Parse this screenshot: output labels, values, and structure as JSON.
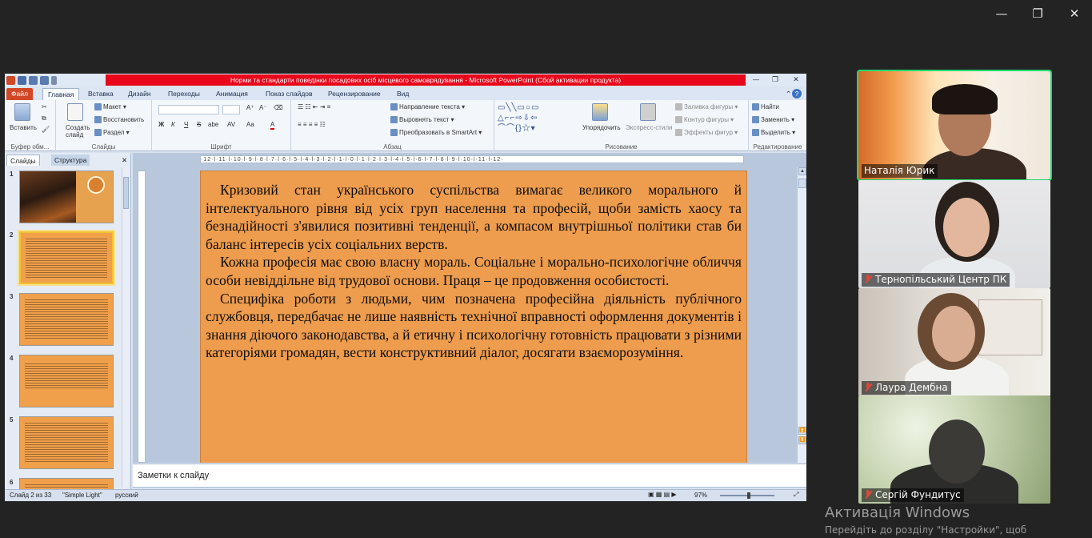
{
  "app_window": {
    "controls": [
      "minimize-icon",
      "restore-icon",
      "close-icon"
    ]
  },
  "ppt": {
    "title": "Норми та стандарти поведінки посадових осіб місцевого самоврядування  -  Microsoft PowerPoint (Сбой активации продукта)",
    "tabs": [
      "Файл",
      "Главная",
      "Вставка",
      "Дизайн",
      "Переходы",
      "Анимация",
      "Показ слайдов",
      "Рецензирование",
      "Вид"
    ],
    "ribbon": {
      "clipboard": {
        "paste": "Вставить",
        "label": "Буфер обм..."
      },
      "slides": {
        "new_slide": "Создать слайд",
        "layout": "Макет",
        "reset": "Восстановить",
        "section": "Раздел",
        "label": "Слайды"
      },
      "font": {
        "label": "Шрифт",
        "bold": "Ж",
        "italic": "К",
        "underline": "Ч",
        "strike": "S",
        "shadow": "abe",
        "spacing": "AV",
        "case": "Aa",
        "color": "A"
      },
      "paragraph": {
        "label": "Абзац",
        "text_dir": "Направление текста",
        "align_text": "Выровнять текст",
        "smartart": "Преобразовать в SmartArt"
      },
      "drawing": {
        "arrange": "Упорядочить",
        "quick_styles": "Экспресс-стили",
        "fill": "Заливка фигуры",
        "outline": "Контур фигуры",
        "effects": "Эффекты фигур",
        "label": "Рисование"
      },
      "editing": {
        "find": "Найти",
        "replace": "Заменить",
        "select": "Выделить",
        "label": "Редактирование"
      }
    },
    "left_panel": {
      "tab_slides": "Слайды",
      "tab_outline": "Структура",
      "thumb_numbers": [
        "1",
        "2",
        "3",
        "4",
        "5",
        "6"
      ]
    },
    "ruler_text": "·12·l·11·l·10·l·9·l·8·l·7·l·6·l·5·l·4·l·3·l·2·l·1·l·0·l·1·l·2·l·3·l·4·l·5·l·6·l·7·l·8·l·9·l·10·l·11·l·12·",
    "slide": {
      "p1": "Кризовий стан українського суспільства вимагає великого морального й інтелектуального рівня від усіх груп населення та професій, щоби замість хаосу та безнадійності з'явилися позитивні тенденції, а компасом внутрішньої політики став би баланс інтересів усіх соціальних верств.",
      "p2": "Кожна професія має свою власну мораль. Соціальне і морально-психологічне обличчя особи невіддільне від трудової основи. Праця – це продовження особистості.",
      "p3": "Специфіка роботи з людьми, чим позначена професійна діяльність публічного службовця, передбачає не лише наявність технічної вправності оформлення документів і знання діючого законодавства, а й етичну і психологічну готовність працювати з різними категоріями громадян, вести конструктивний діалог, досягати взаєморозуміння."
    },
    "notes_placeholder": "Заметки к слайду",
    "status": {
      "slide": "Слайд 2 из 33",
      "theme": "\"Simple Light\"",
      "lang": "русский",
      "zoom": "97%"
    }
  },
  "participants": [
    {
      "name": "Наталія Юрик",
      "muted": false,
      "speaking": true
    },
    {
      "name": "Тернопільський Центр ПК",
      "muted": true,
      "speaking": false
    },
    {
      "name": "Лаура Дембна",
      "muted": true,
      "speaking": false
    },
    {
      "name": "Сергій Фундитус",
      "muted": true,
      "speaking": false
    }
  ],
  "windows_activation": {
    "title": "Активація Windows",
    "subtitle": "Перейдіть до розділу \"Настройки\", щоб"
  }
}
